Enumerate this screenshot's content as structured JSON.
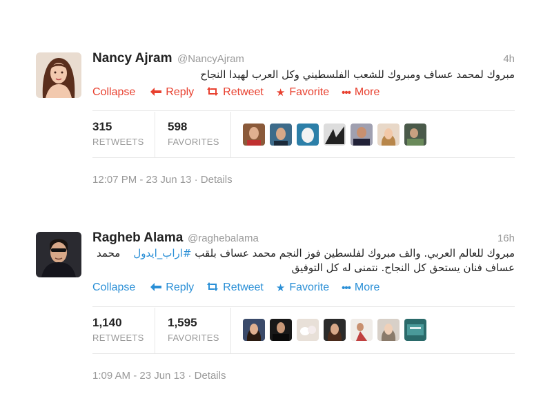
{
  "tweets": [
    {
      "name": "Nancy Ajram",
      "handle": "@NancyAjram",
      "time": "4h",
      "text_line1": "مبروك لمحمد عساف ومبروك للشعب الفلسطيني وكل العرب لهيدا النجاح",
      "text_line2": "",
      "hashtag": "",
      "actions": {
        "collapse": "Collapse",
        "reply": "Reply",
        "retweet": "Retweet",
        "favorite": "Favorite",
        "more": "More"
      },
      "action_color": "#e8402f",
      "retweets_count": "315",
      "retweets_label": "RETWEETS",
      "favorites_count": "598",
      "favorites_label": "FAVORITES",
      "timestamp": "12:07 PM - 23 Jun 13",
      "details": "Details"
    },
    {
      "name": "Ragheb Alama",
      "handle": "@raghebalama",
      "time": "16h",
      "text_line1": "مبروك للعالم العربي. والف مبروك لفلسطين فوز النجم محمد عساف بلقب",
      "hashtag": "#اراب_ايدول",
      "text_line1_end": "محمد",
      "text_line2": "عساف فنان يستحق كل النجاح. نتمنى له كل التوفيق",
      "actions": {
        "collapse": "Collapse",
        "reply": "Reply",
        "retweet": "Retweet",
        "favorite": "Favorite",
        "more": "More"
      },
      "action_color": "#2a8fd6",
      "retweets_count": "1,140",
      "retweets_label": "RETWEETS",
      "favorites_count": "1,595",
      "favorites_label": "FAVORITES",
      "timestamp": "1:09 AM - 23 Jun 13",
      "details": "Details"
    }
  ],
  "icons": {
    "reply": "reply-arrow-icon",
    "retweet": "retweet-icon",
    "favorite": "star-icon",
    "more": "ellipsis-icon"
  }
}
